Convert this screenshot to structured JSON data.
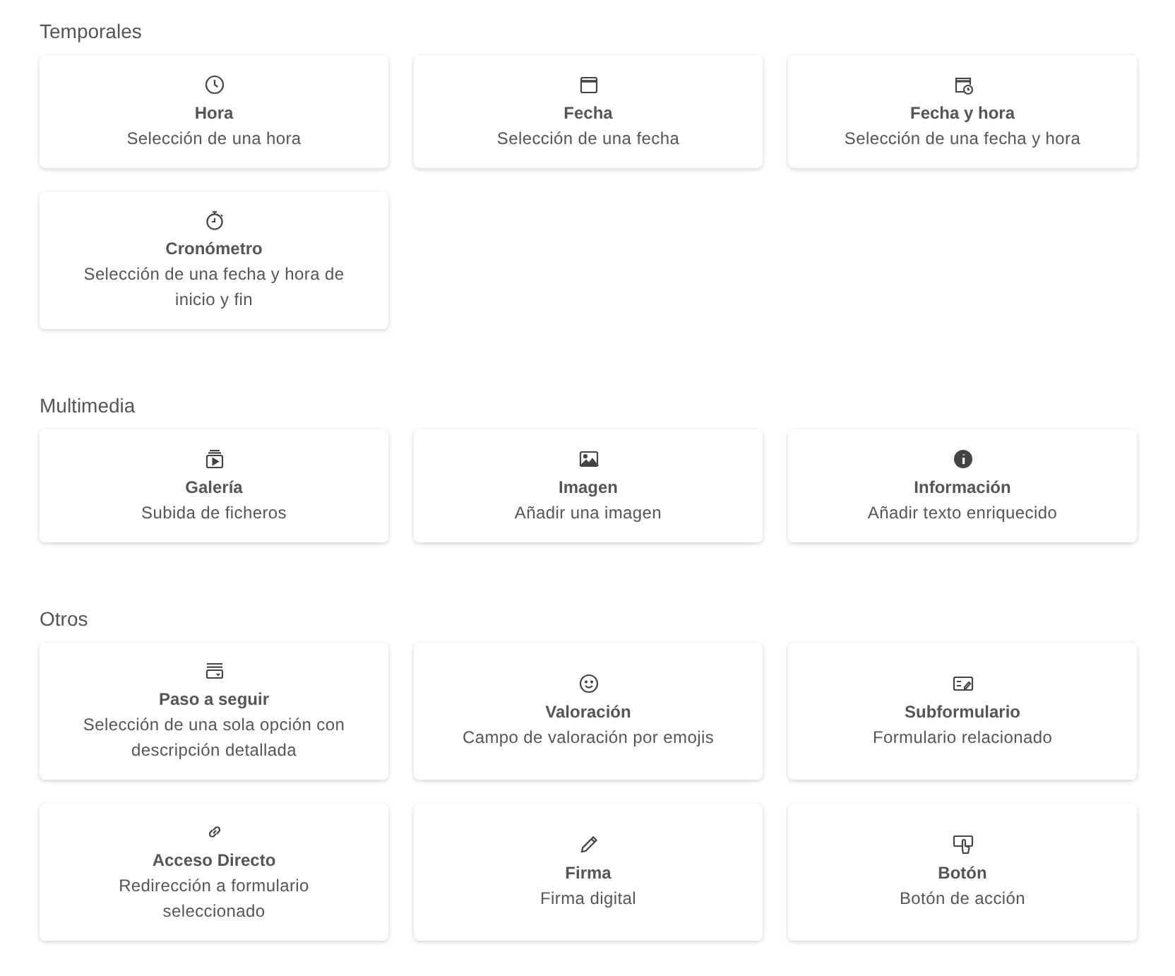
{
  "sections": [
    {
      "title": "Temporales",
      "items": [
        {
          "kind": "clock",
          "title": "Hora",
          "description": "Selección de una hora"
        },
        {
          "kind": "calendar",
          "title": "Fecha",
          "description": "Selección de una fecha"
        },
        {
          "kind": "calendar-clock",
          "title": "Fecha y hora",
          "description": "Selección de una fecha y hora"
        },
        {
          "kind": "stopwatch",
          "title": "Cronómetro",
          "description": "Selección de una fecha y hora de inicio y fin"
        }
      ]
    },
    {
      "title": "Multimedia",
      "items": [
        {
          "kind": "gallery",
          "title": "Galería",
          "description": "Subida de ficheros"
        },
        {
          "kind": "image",
          "title": "Imagen",
          "description": "Añadir una imagen"
        },
        {
          "kind": "info",
          "title": "Información",
          "description": "Añadir texto enriquecido"
        }
      ]
    },
    {
      "title": "Otros",
      "items": [
        {
          "kind": "steps",
          "title": "Paso a seguir",
          "description": "Selección de una sola opción con descripción detallada"
        },
        {
          "kind": "smile",
          "title": "Valoración",
          "description": "Campo de valoración por emojis"
        },
        {
          "kind": "subform",
          "title": "Subformulario",
          "description": "Formulario relacionado"
        },
        {
          "kind": "link",
          "title": "Acceso Directo",
          "description": "Redirección a formulario seleccionado"
        },
        {
          "kind": "pencil",
          "title": "Firma",
          "description": "Firma digital"
        },
        {
          "kind": "touch",
          "title": "Botón",
          "description": "Botón de acción"
        }
      ]
    }
  ]
}
